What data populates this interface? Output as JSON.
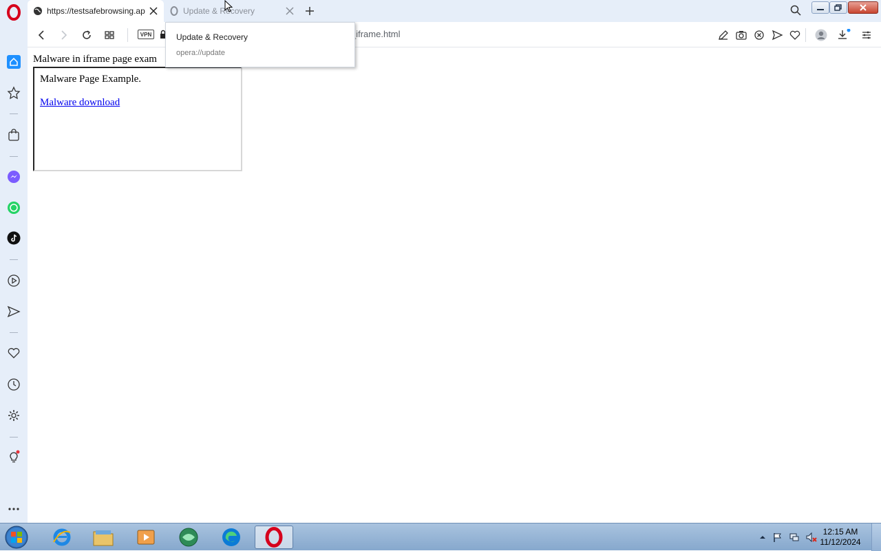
{
  "browser": {
    "tabs": [
      {
        "title": "https://testsafebrowsing.ap",
        "active": true
      },
      {
        "title": "Update & Recovery",
        "active": false
      }
    ],
    "address_bar": {
      "vpn_label": "VPN",
      "url_visible": "_iframe.html"
    },
    "tooltip": {
      "title": "Update & Recovery",
      "url": "opera://update"
    }
  },
  "page": {
    "heading": "Malware in iframe page exam",
    "iframe": {
      "text": "Malware Page Example.",
      "link": "Malware download"
    }
  },
  "taskbar": {
    "clock_time": "12:15 AM",
    "clock_date": "11/12/2024"
  },
  "colors": {
    "chrome_bg": "#e6eef9",
    "opera_red": "#d6001c",
    "link": "#0000ee",
    "sidebar_active": "#1e90ff"
  }
}
